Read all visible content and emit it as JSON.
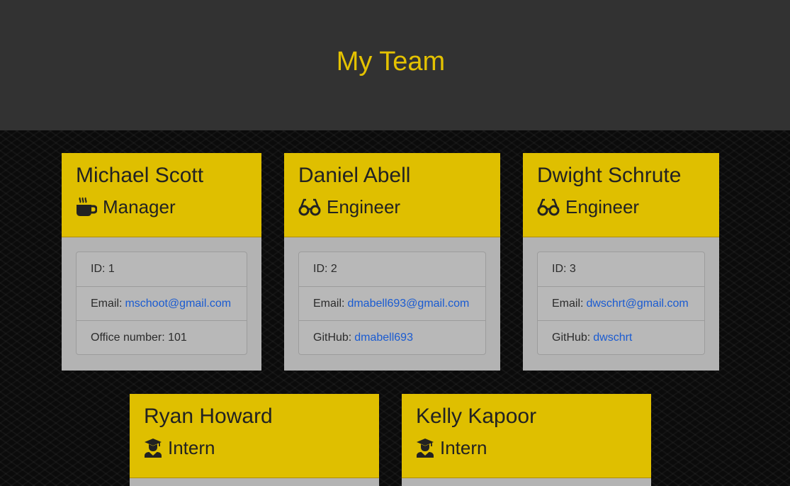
{
  "header": {
    "title": "My Team"
  },
  "colors": {
    "accent": "#dfbf00",
    "link": "#1a5bd1",
    "header_bg": "#323232"
  },
  "cards": [
    {
      "name": "Michael Scott",
      "role": "Manager",
      "icon": "coffee-icon",
      "id_label": "ID: 1",
      "email_label": "Email:",
      "email": "mschoot@gmail.com",
      "extra_label": "Office number: 101",
      "extra_value": ""
    },
    {
      "name": "Daniel Abell",
      "role": "Engineer",
      "icon": "glasses-icon",
      "id_label": "ID: 2",
      "email_label": "Email:",
      "email": "dmabell693@gmail.com",
      "extra_label": "GitHub:",
      "extra_value": "dmabell693"
    },
    {
      "name": "Dwight Schrute",
      "role": "Engineer",
      "icon": "glasses-icon",
      "id_label": "ID: 3",
      "email_label": "Email:",
      "email": "dwschrt@gmail.com",
      "extra_label": "GitHub:",
      "extra_value": "dwschrt"
    },
    {
      "name": "Ryan Howard",
      "role": "Intern",
      "icon": "graduate-icon"
    },
    {
      "name": "Kelly Kapoor",
      "role": "Intern",
      "icon": "graduate-icon"
    }
  ]
}
